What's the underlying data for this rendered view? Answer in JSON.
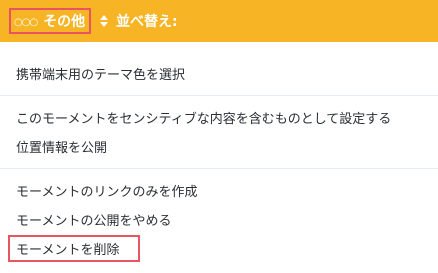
{
  "toolbar": {
    "other_label": "その他",
    "other_icon": "ellipsis-icon",
    "sort_label": "並べ替え:",
    "sort_icon": "sort-arrows-icon",
    "background_color": "#f7b424"
  },
  "menu": {
    "group1": [
      "携帯端末用のテーマ色を選択"
    ],
    "group2": [
      "このモーメントをセンシティブな内容を含むものとして設定する",
      "位置情報を公開"
    ],
    "group3": [
      "モーメントのリンクのみを作成",
      "モーメントの公開をやめる",
      "モーメントを削除"
    ]
  },
  "highlight_color": "#e8545f"
}
